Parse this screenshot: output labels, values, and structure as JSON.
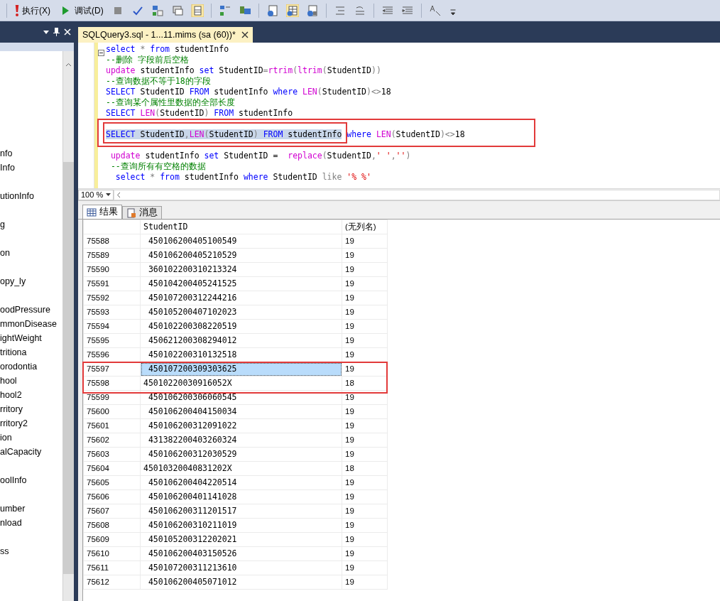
{
  "toolbar": {
    "buttons": [
      {
        "label": "执行(X)",
        "kind": "execute"
      },
      {
        "label": "调试(D)",
        "kind": "debug"
      }
    ]
  },
  "document_tab": {
    "title": "SQLQuery3.sql - 1...11.mims (sa (60))*",
    "selected": true
  },
  "object_explorer": {
    "groups": [
      {
        "items": [
          "nfo",
          "Info"
        ]
      },
      {
        "items": [
          "utionInfo"
        ]
      },
      {
        "items": [
          "g"
        ]
      },
      {
        "items": [
          "on"
        ]
      },
      {
        "items": [
          "opy_ly"
        ]
      },
      {
        "items": [
          "oodPressure",
          "mmonDisease",
          "ightWeight",
          "tritiona",
          "orodontia",
          "hool",
          "hool2",
          "rritory",
          "rritory2",
          "ion",
          "alCapacity"
        ]
      },
      {
        "items": [
          "oolInfo"
        ]
      },
      {
        "items": [
          "umber",
          "nload"
        ]
      },
      {
        "items": [
          "ss"
        ]
      }
    ]
  },
  "editor": {
    "lines": [
      {
        "kind": "code",
        "tokens": [
          {
            "kind": "kw",
            "text": "select",
            "selected": false
          },
          {
            "kind": "op",
            "text": " * ",
            "selected": false
          },
          {
            "kind": "kw",
            "text": "from",
            "selected": false
          },
          {
            "kind": "tx",
            "text": " studentInfo",
            "selected": false
          }
        ]
      },
      {
        "kind": "code",
        "tokens": [
          {
            "kind": "cm",
            "text": "--删除 字段前后空格",
            "selected": false
          }
        ]
      },
      {
        "kind": "code",
        "tokens": [
          {
            "kind": "fn",
            "text": "update",
            "selected": false
          },
          {
            "kind": "tx",
            "text": " studentInfo ",
            "selected": false
          },
          {
            "kind": "kw",
            "text": "set",
            "selected": false
          },
          {
            "kind": "tx",
            "text": " StudentID",
            "selected": false
          },
          {
            "kind": "op",
            "text": "=",
            "selected": false
          },
          {
            "kind": "fn",
            "text": "rtrim",
            "selected": false
          },
          {
            "kind": "op",
            "text": "(",
            "selected": false
          },
          {
            "kind": "fn",
            "text": "ltrim",
            "selected": false
          },
          {
            "kind": "op",
            "text": "(",
            "selected": false
          },
          {
            "kind": "tx",
            "text": "StudentID",
            "selected": false
          },
          {
            "kind": "op",
            "text": "))",
            "selected": false
          }
        ]
      },
      {
        "kind": "code",
        "tokens": [
          {
            "kind": "cm",
            "text": "--查询数据不等于18的字段",
            "selected": false
          }
        ]
      },
      {
        "kind": "code",
        "tokens": [
          {
            "kind": "kw",
            "text": "SELECT",
            "selected": false
          },
          {
            "kind": "tx",
            "text": " StudentID ",
            "selected": false
          },
          {
            "kind": "kw",
            "text": "FROM",
            "selected": false
          },
          {
            "kind": "tx",
            "text": " studentInfo ",
            "selected": false
          },
          {
            "kind": "kw",
            "text": "where",
            "selected": false
          },
          {
            "kind": "fn",
            "text": " LEN",
            "selected": false
          },
          {
            "kind": "op",
            "text": "(",
            "selected": false
          },
          {
            "kind": "tx",
            "text": "StudentID",
            "selected": false
          },
          {
            "kind": "op",
            "text": ")<>",
            "selected": false
          },
          {
            "kind": "tx",
            "text": "18",
            "selected": false
          }
        ]
      },
      {
        "kind": "code",
        "tokens": [
          {
            "kind": "cm",
            "text": "--查询某个属性里数据的全部长度",
            "selected": false
          }
        ]
      },
      {
        "kind": "code",
        "tokens": [
          {
            "kind": "kw",
            "text": "SELECT",
            "selected": false
          },
          {
            "kind": "fn",
            "text": " LEN",
            "selected": false
          },
          {
            "kind": "op",
            "text": "(",
            "selected": false
          },
          {
            "kind": "tx",
            "text": "StudentID",
            "selected": false
          },
          {
            "kind": "op",
            "text": ")",
            "selected": false
          },
          {
            "kind": "kw",
            "text": " FROM",
            "selected": false
          },
          {
            "kind": "tx",
            "text": " studentInfo",
            "selected": false
          }
        ]
      },
      {
        "kind": "blank"
      },
      {
        "kind": "code",
        "tokens": [
          {
            "kind": "kw",
            "text": "SELECT",
            "selected": true
          },
          {
            "kind": "tx",
            "text": " StudentID",
            "selected": true
          },
          {
            "kind": "op",
            "text": ",",
            "selected": true
          },
          {
            "kind": "fn",
            "text": "LEN",
            "selected": true
          },
          {
            "kind": "op",
            "text": "(",
            "selected": true
          },
          {
            "kind": "tx",
            "text": "StudentID",
            "selected": true
          },
          {
            "kind": "op",
            "text": ")",
            "selected": true
          },
          {
            "kind": "kw",
            "text": " FROM",
            "selected": true
          },
          {
            "kind": "tx",
            "text": " studentInfo",
            "selected": true
          },
          {
            "kind": "kw",
            "text": " where",
            "selected": false
          },
          {
            "kind": "fn",
            "text": " LEN",
            "selected": false
          },
          {
            "kind": "op",
            "text": "(",
            "selected": false
          },
          {
            "kind": "tx",
            "text": "StudentID",
            "selected": false
          },
          {
            "kind": "op",
            "text": ")<>",
            "selected": false
          },
          {
            "kind": "tx",
            "text": "18",
            "selected": false
          }
        ]
      },
      {
        "kind": "blank"
      },
      {
        "kind": "code",
        "tokens": [
          {
            "kind": "fn",
            "text": " update",
            "selected": false
          },
          {
            "kind": "tx",
            "text": " studentInfo ",
            "selected": false
          },
          {
            "kind": "kw",
            "text": "set",
            "selected": false
          },
          {
            "kind": "tx",
            "text": " StudentID =  ",
            "selected": false
          },
          {
            "kind": "fn",
            "text": "replace",
            "selected": false
          },
          {
            "kind": "op",
            "text": "(",
            "selected": false
          },
          {
            "kind": "tx",
            "text": "StudentID",
            "selected": false
          },
          {
            "kind": "op",
            "text": ",",
            "selected": false
          },
          {
            "kind": "str",
            "text": "' '",
            "selected": false
          },
          {
            "kind": "op",
            "text": ",",
            "selected": false
          },
          {
            "kind": "str",
            "text": "''",
            "selected": false
          },
          {
            "kind": "op",
            "text": ")",
            "selected": false
          }
        ]
      },
      {
        "kind": "code",
        "tokens": [
          {
            "kind": "cm",
            "text": " --查询所有有空格的数据",
            "selected": false
          }
        ]
      },
      {
        "kind": "code",
        "tokens": [
          {
            "kind": "kw",
            "text": "  select",
            "selected": false
          },
          {
            "kind": "op",
            "text": " * ",
            "selected": false
          },
          {
            "kind": "kw",
            "text": "from",
            "selected": false
          },
          {
            "kind": "tx",
            "text": " studentInfo ",
            "selected": false
          },
          {
            "kind": "kw",
            "text": "where",
            "selected": false
          },
          {
            "kind": "tx",
            "text": " StudentID ",
            "selected": false
          },
          {
            "kind": "op",
            "text": "like",
            "selected": false
          },
          {
            "kind": "str",
            "text": " '% %'",
            "selected": false
          }
        ]
      }
    ],
    "zoom": "100 %"
  },
  "results_tabs": [
    {
      "label": "结果",
      "kind": "grid",
      "selected": true
    },
    {
      "label": "消息",
      "kind": "messages",
      "selected": false
    }
  ],
  "grid": {
    "columns": [
      "StudentID",
      "(无列名)"
    ],
    "rows": [
      {
        "row": "75588",
        "cells": [
          " 450106200405100549",
          "19"
        ],
        "selected": false
      },
      {
        "row": "75589",
        "cells": [
          " 450106200405210529",
          "19"
        ],
        "selected": false
      },
      {
        "row": "75590",
        "cells": [
          " 360102200310213324",
          "19"
        ],
        "selected": false
      },
      {
        "row": "75591",
        "cells": [
          " 450104200405241525",
          "19"
        ],
        "selected": false
      },
      {
        "row": "75592",
        "cells": [
          " 450107200312244216",
          "19"
        ],
        "selected": false
      },
      {
        "row": "75593",
        "cells": [
          " 450105200407102023",
          "19"
        ],
        "selected": false
      },
      {
        "row": "75594",
        "cells": [
          " 450102200308220519",
          "19"
        ],
        "selected": false
      },
      {
        "row": "75595",
        "cells": [
          " 450621200308294012",
          "19"
        ],
        "selected": false
      },
      {
        "row": "75596",
        "cells": [
          " 450102200310132518",
          "19"
        ],
        "selected": false
      },
      {
        "row": "75597",
        "cells": [
          " 450107200309303625",
          "19"
        ],
        "selected": true
      },
      {
        "row": "75598",
        "cells": [
          "45010220030916052X",
          "18"
        ],
        "selected": false
      },
      {
        "row": "75599",
        "cells": [
          " 450106200306060545",
          "19"
        ],
        "selected": false
      },
      {
        "row": "75600",
        "cells": [
          " 450106200404150034",
          "19"
        ],
        "selected": false
      },
      {
        "row": "75601",
        "cells": [
          " 450106200312091022",
          "19"
        ],
        "selected": false
      },
      {
        "row": "75602",
        "cells": [
          " 431382200403260324",
          "19"
        ],
        "selected": false
      },
      {
        "row": "75603",
        "cells": [
          " 450106200312030529",
          "19"
        ],
        "selected": false
      },
      {
        "row": "75604",
        "cells": [
          "45010320040831202X",
          "18"
        ],
        "selected": false
      },
      {
        "row": "75605",
        "cells": [
          " 450106200404220514",
          "19"
        ],
        "selected": false
      },
      {
        "row": "75606",
        "cells": [
          " 450106200401141028",
          "19"
        ],
        "selected": false
      },
      {
        "row": "75607",
        "cells": [
          " 450106200311201517",
          "19"
        ],
        "selected": false
      },
      {
        "row": "75608",
        "cells": [
          " 450106200310211019",
          "19"
        ],
        "selected": false
      },
      {
        "row": "75609",
        "cells": [
          " 450105200312202021",
          "19"
        ],
        "selected": false
      },
      {
        "row": "75610",
        "cells": [
          " 450106200403150526",
          "19"
        ],
        "selected": false
      },
      {
        "row": "75611",
        "cells": [
          " 450107200311213610",
          "19"
        ],
        "selected": false
      },
      {
        "row": "75612",
        "cells": [
          " 450106200405071012",
          "19"
        ],
        "selected": false
      }
    ]
  }
}
